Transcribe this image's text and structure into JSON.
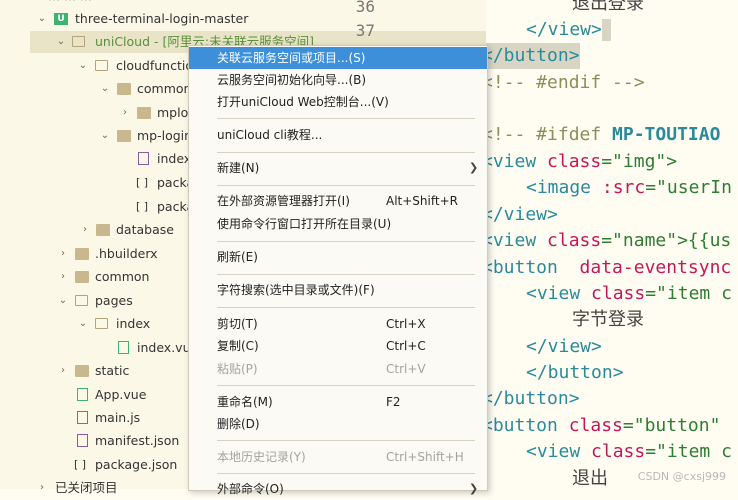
{
  "tree": {
    "top_partial": "··· ··· ···",
    "project": "three-terminal-login-master",
    "unicloud": "uniCloud - [阿里云:未关联云服务空间]",
    "cloudfunctions": "cloudfunctions",
    "common": "common",
    "mplog": "mplog",
    "mp_login": "mp-login",
    "index_file": "index.",
    "package1": "packa",
    "package2": "packa",
    "database": "database",
    "hbuilderx": ".hbuilderx",
    "common2": "common",
    "pages": "pages",
    "index_folder": "index",
    "index_vue": "index.vue",
    "static": "static",
    "app_vue": "App.vue",
    "main_js": "main.js",
    "manifest": "manifest.json",
    "package_json": "package.json",
    "closed_projects": "已关闭项目"
  },
  "editor": {
    "line36": "36",
    "line37": "37",
    "l0": "退出登录",
    "l1_tag": "</view>",
    "l2_tag": "</button>",
    "l3": "<!-- #endif -->",
    "l4_a": "<!-- #ifdef ",
    "l4_b": "MP-TOUTIAO",
    "l5_a": "<view ",
    "l5_b": "class",
    "l5_c": "=\"img\">",
    "l6_a": "<image ",
    "l6_b": ":src",
    "l6_c": "=\"userIn",
    "l7": "</view>",
    "l8_a": "<view ",
    "l8_b": "class",
    "l8_c": "=\"name\">{{us",
    "l9_a": "<button  ",
    "l9_b": "data-eventsync",
    "l10_a": "<view ",
    "l10_b": "class",
    "l10_c": "=\"item c",
    "l11": "字节登录",
    "l12": "</view>",
    "l13": "</button>",
    "l14": "</button>",
    "l15_a": "<button ",
    "l15_b": "class",
    "l15_c": "=\"button\"",
    "l16_a": "<view ",
    "l16_b": "class",
    "l16_c": "=\"item c",
    "l17": "退出"
  },
  "menu": {
    "items": [
      {
        "label": "关联云服务空间或项目...(S)",
        "shortcut": ""
      },
      {
        "label": "云服务空间初始化向导...(B)",
        "shortcut": ""
      },
      {
        "label": "打开uniCloud Web控制台...(V)",
        "shortcut": ""
      },
      {
        "label": "uniCloud cli教程...",
        "shortcut": ""
      },
      {
        "label": "新建(N)",
        "shortcut": ""
      },
      {
        "label": "在外部资源管理器打开(I)",
        "shortcut": "Alt+Shift+R"
      },
      {
        "label": "使用命令行窗口打开所在目录(U)",
        "shortcut": ""
      },
      {
        "label": "刷新(E)",
        "shortcut": ""
      },
      {
        "label": "字符搜索(选中目录或文件)(F)",
        "shortcut": ""
      },
      {
        "label": "剪切(T)",
        "shortcut": "Ctrl+X"
      },
      {
        "label": "复制(C)",
        "shortcut": "Ctrl+C"
      },
      {
        "label": "粘贴(P)",
        "shortcut": "Ctrl+V"
      },
      {
        "label": "重命名(M)",
        "shortcut": "F2"
      },
      {
        "label": "删除(D)",
        "shortcut": ""
      },
      {
        "label": "本地历史记录(Y)",
        "shortcut": "Ctrl+Shift+H"
      },
      {
        "label": "外部命令(O)",
        "shortcut": ""
      }
    ]
  },
  "watermark": "CSDN @cxsj999"
}
